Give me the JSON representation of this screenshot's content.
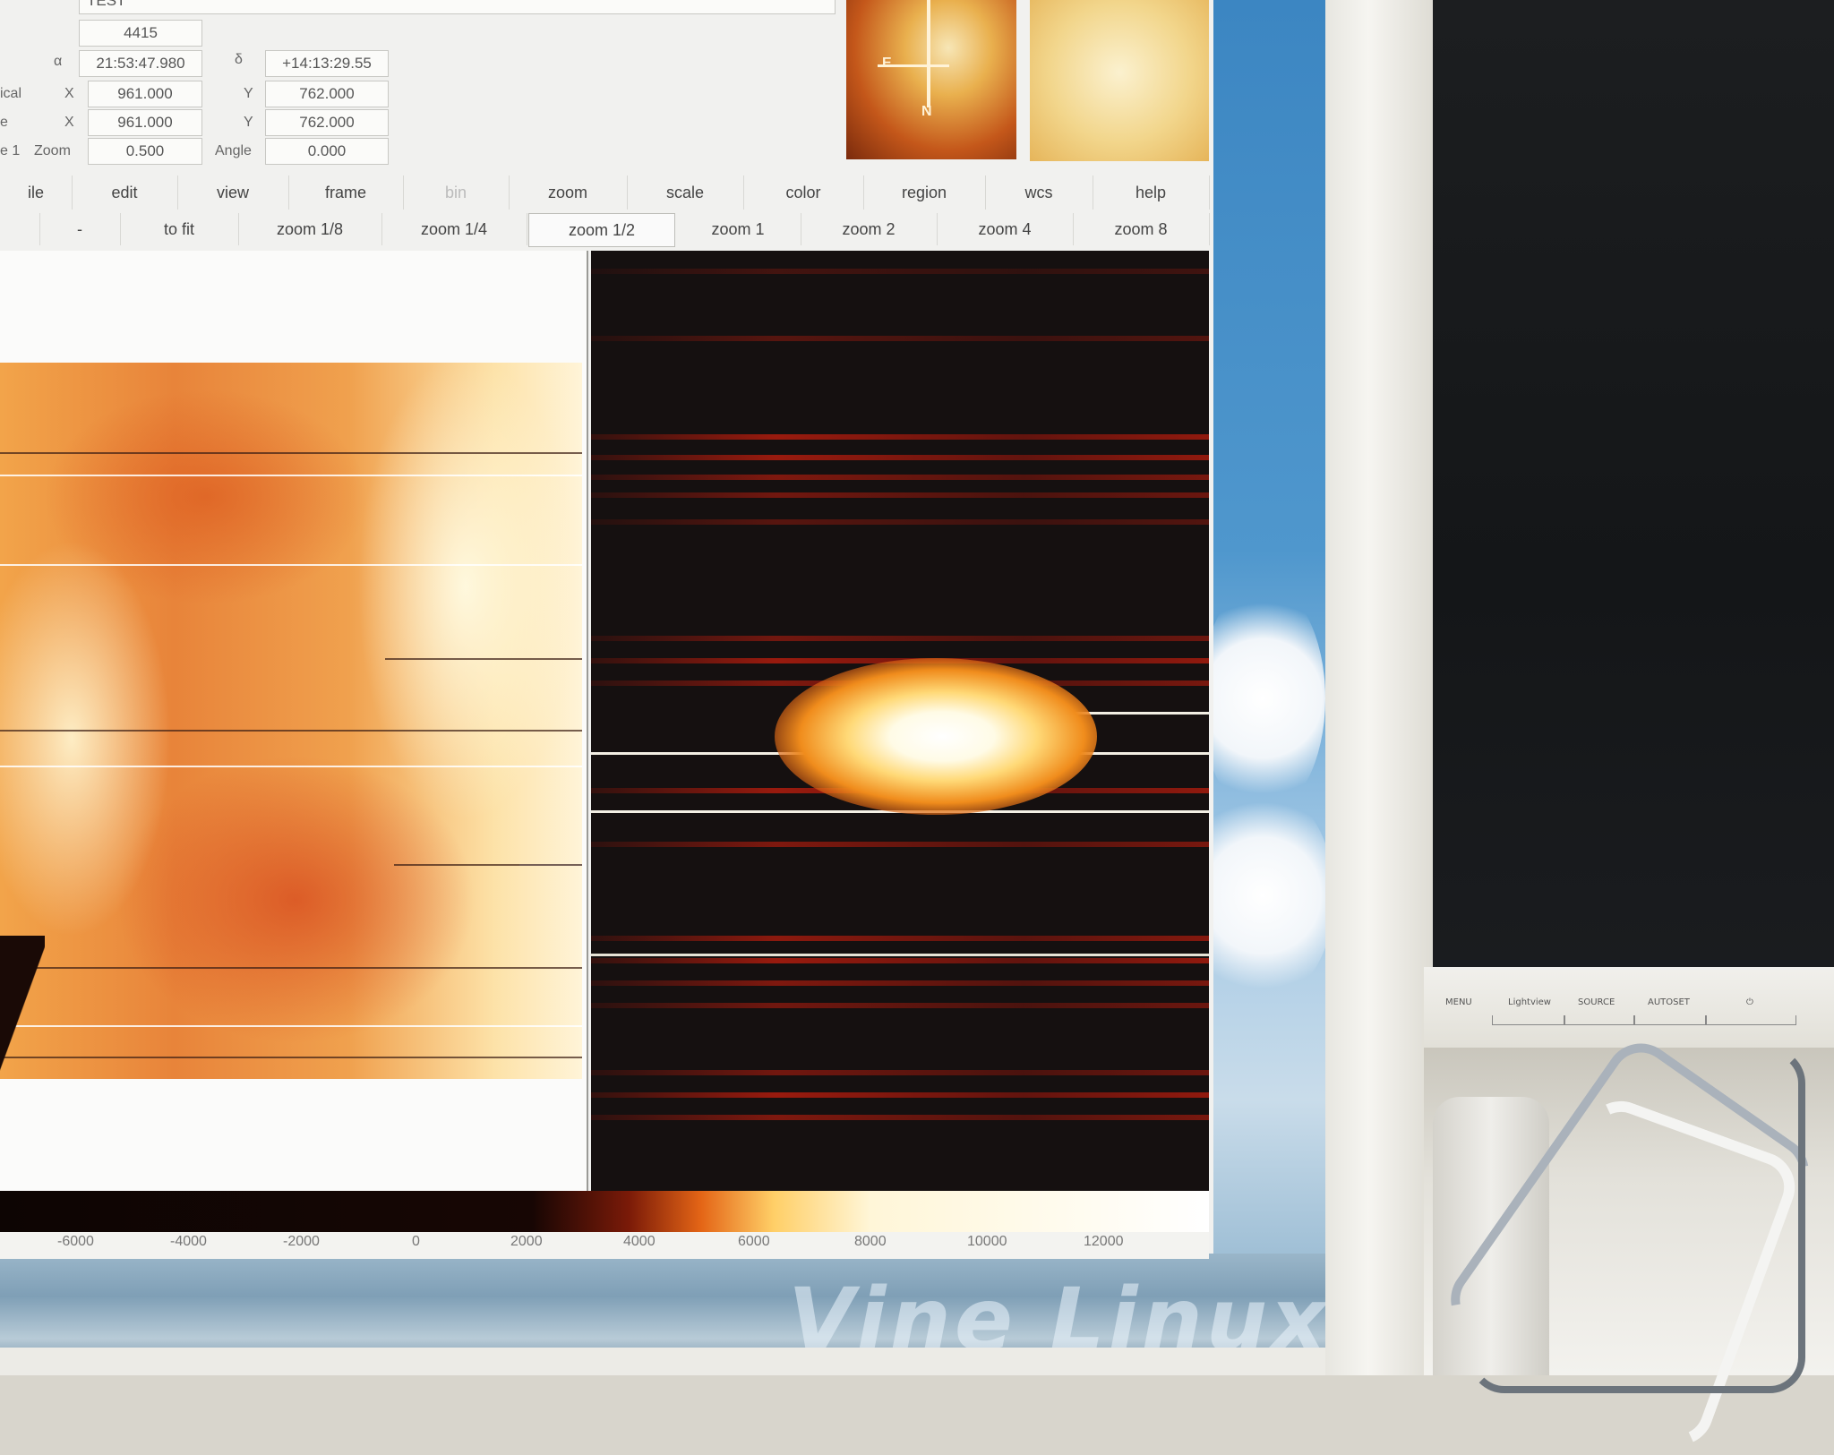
{
  "info_panel": {
    "object": "TEST",
    "value": "4415",
    "ra": "21:53:47.980",
    "dec": "+14:13:29.55",
    "alpha_label": "α",
    "delta_label": "δ",
    "physical": {
      "label": "ical",
      "x_label": "X",
      "x": "961.000",
      "y_label": "Y",
      "y": "762.000"
    },
    "image": {
      "label": "e",
      "x_label": "X",
      "x": "961.000",
      "y_label": "Y",
      "y": "762.000"
    },
    "frame": {
      "label": "e 1",
      "zoom_label": "Zoom",
      "zoom": "0.500",
      "angle_label": "Angle",
      "angle": "0.000"
    }
  },
  "panner": {
    "compass_n": "N",
    "compass_e": "E"
  },
  "menu": [
    "ile",
    "edit",
    "view",
    "frame",
    "bin",
    "zoom",
    "scale",
    "color",
    "region",
    "wcs",
    "help"
  ],
  "zoom_buttons": [
    "-",
    "to fit",
    "zoom 1/8",
    "zoom 1/4",
    "zoom 1/2",
    "zoom 1",
    "zoom 2",
    "zoom 4",
    "zoom 8"
  ],
  "active_zoom": "zoom 1/2",
  "colorbar_ticks": [
    "-6000",
    "-4000",
    "-2000",
    "0",
    "2000",
    "4000",
    "6000",
    "8000",
    "10000",
    "12000"
  ],
  "watermark": "Vine Linux",
  "monitor2": {
    "buttons": [
      "MENU",
      "Lightview",
      "SOURCE",
      "AUTOSET",
      "⏻"
    ]
  },
  "colors": {
    "heat_dark": "#151010",
    "heat_red": "#b01c0e",
    "heat_orange": "#f08c1c",
    "heat_white": "#ffffff",
    "sky": "#3c86c2"
  }
}
